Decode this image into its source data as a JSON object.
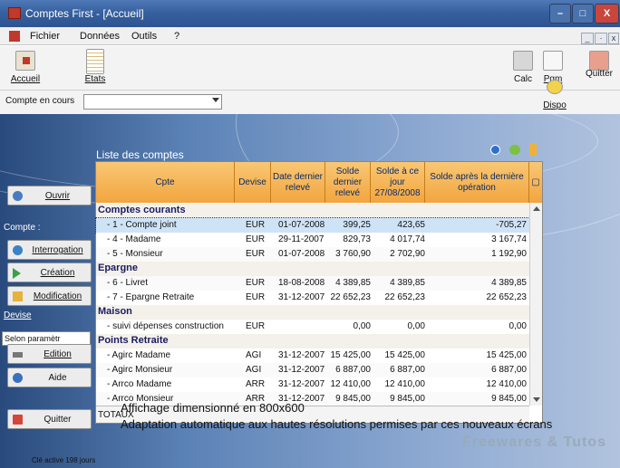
{
  "window": {
    "title": "Comptes First - [Accueil]",
    "minimize": "–",
    "maximize": "□",
    "close": "X"
  },
  "menu": {
    "items": [
      "Fichier",
      "Données",
      "Outils",
      "?"
    ],
    "mdi": [
      "_",
      "·",
      "x"
    ]
  },
  "toolbar": {
    "accueil": "Accueil",
    "etats": "Etats",
    "calc": "Calc",
    "pgm": "Pgm",
    "dispo": "Dispo",
    "quitter": "Quitter"
  },
  "account": {
    "label": "Compte en cours",
    "value": ""
  },
  "sidebar": {
    "ouvrir": "Ouvrir",
    "compte_label": "Compte :",
    "interrogation": "Interrogation",
    "creation": "Création",
    "modification": "Modification",
    "devise_label": "Devise",
    "devise_value": "Selon paramètr",
    "edition": "Edition",
    "aide": "Aide",
    "quitter": "Quitter"
  },
  "list": {
    "title": "Liste des comptes",
    "columns": [
      "Cpte",
      "Devise",
      "Date dernier relevé",
      "Solde dernier relevé",
      "Solde à ce jour 27/08/2008",
      "Solde après la dernière opération"
    ],
    "rows": [
      {
        "type": "group",
        "label": "Comptes courants"
      },
      {
        "type": "item",
        "cpte": "- 1 - Compte joint",
        "devise": "EUR",
        "date": "01-07-2008",
        "solde_releve": "399,25",
        "solde_jour": "423,65",
        "solde_apres": "-705,27",
        "selected": true
      },
      {
        "type": "item",
        "cpte": "- 4 - Madame",
        "devise": "EUR",
        "date": "29-11-2007",
        "solde_releve": "829,73",
        "solde_jour": "4 017,74",
        "solde_apres": "3 167,74"
      },
      {
        "type": "item",
        "cpte": "- 5 - Monsieur",
        "devise": "EUR",
        "date": "01-07-2008",
        "solde_releve": "3 760,90",
        "solde_jour": "2 702,90",
        "solde_apres": "1 192,90"
      },
      {
        "type": "group",
        "label": "Epargne"
      },
      {
        "type": "item",
        "cpte": "- 6 - Livret",
        "devise": "EUR",
        "date": "18-08-2008",
        "solde_releve": "4 389,85",
        "solde_jour": "4 389,85",
        "solde_apres": "4 389,85"
      },
      {
        "type": "item",
        "cpte": "- 7 - Epargne Retraite",
        "devise": "EUR",
        "date": "31-12-2007",
        "solde_releve": "22 652,23",
        "solde_jour": "22 652,23",
        "solde_apres": "22 652,23"
      },
      {
        "type": "group",
        "label": "Maison"
      },
      {
        "type": "item",
        "cpte": "- suivi dépenses construction",
        "devise": "EUR",
        "date": "",
        "solde_releve": "0,00",
        "solde_jour": "0,00",
        "solde_apres": "0,00"
      },
      {
        "type": "group",
        "label": "Points Retraite"
      },
      {
        "type": "item",
        "cpte": "- Agirc Madame",
        "devise": "AGI",
        "date": "31-12-2007",
        "solde_releve": "15 425,00",
        "solde_jour": "15 425,00",
        "solde_apres": "15 425,00"
      },
      {
        "type": "item",
        "cpte": "- Agirc Monsieur",
        "devise": "AGI",
        "date": "31-12-2007",
        "solde_releve": "6 887,00",
        "solde_jour": "6 887,00",
        "solde_apres": "6 887,00"
      },
      {
        "type": "item",
        "cpte": "- Arrco Madame",
        "devise": "ARR",
        "date": "31-12-2007",
        "solde_releve": "12 410,00",
        "solde_jour": "12 410,00",
        "solde_apres": "12 410,00"
      },
      {
        "type": "item",
        "cpte": "- Arrco Monsieur",
        "devise": "ARR",
        "date": "31-12-2007",
        "solde_releve": "9 845,00",
        "solde_jour": "9 845,00",
        "solde_apres": "9 845,00"
      }
    ],
    "footer": "TOTAUX"
  },
  "caption": {
    "line1": "Affichage dimensionné en 800x600",
    "line2": "Adaptation automatique aux hautes résolutions permises par ces nouveaux écrans"
  },
  "status": "Clé active 198 jours",
  "watermark": "Freewares & Tutos"
}
